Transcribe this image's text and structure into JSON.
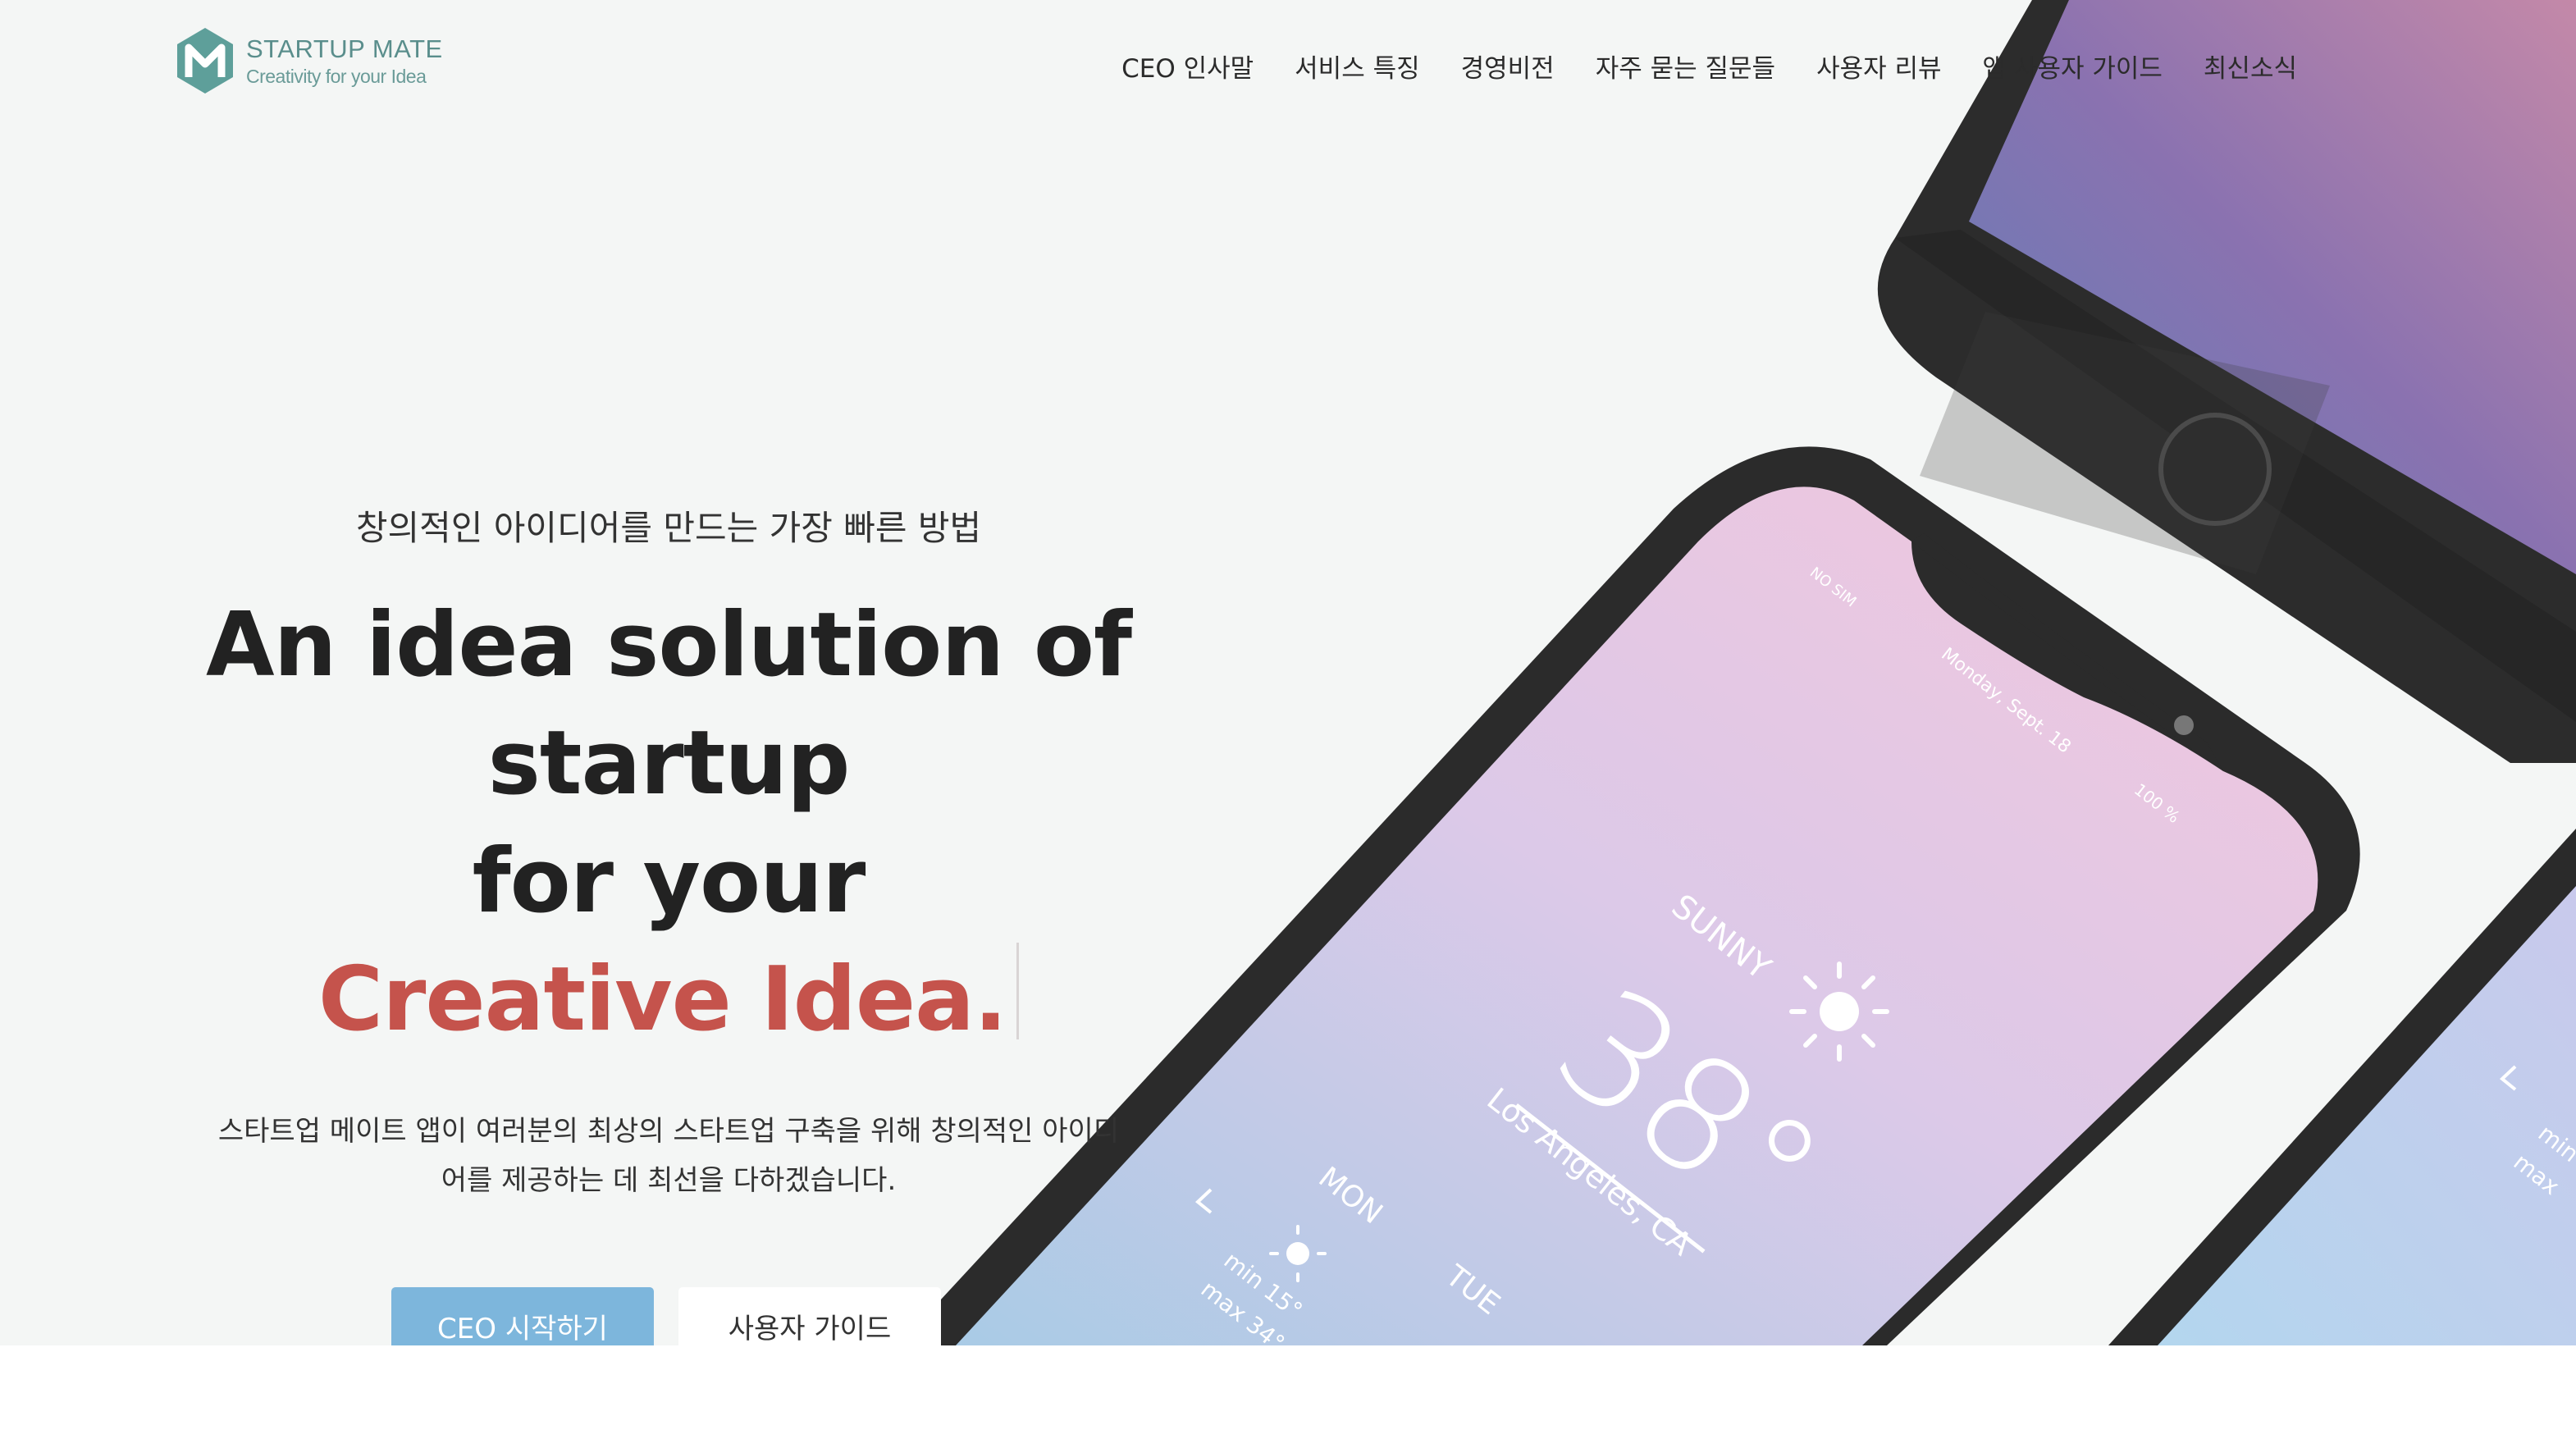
{
  "brand": {
    "name": "STARTUP MATE",
    "tagline": "Creativity for your Idea",
    "icon": "m-logo-icon"
  },
  "nav": {
    "items": [
      "CEO 인사말",
      "서비스 특징",
      "경영비전",
      "자주 묻는 질문들",
      "사용자 리뷰",
      "앱 사용자 가이드",
      "최신소식"
    ]
  },
  "hero": {
    "subtitle": "창의적인 아이디어를 만드는 가장 빠른 방법",
    "headline_line1": "An idea solution of startup",
    "headline_line2": "for your",
    "headline_accent": "Creative Idea.",
    "description": "스타트업 메이트 앱이 여러분의 최상의 스타트업 구축을 위해 창의적인 아이디어를 제공하는 데 최선을 다하겠습니다.",
    "primary_button": "CEO 시작하기",
    "secondary_button": "사용자 가이드"
  },
  "phone_screen": {
    "carrier": "NO SIM",
    "date": "Monday, Sept. 18",
    "battery": "100 %",
    "condition": "SUNNY",
    "temperature": "38°",
    "location": "Los Angeles, CA",
    "day1": "MON",
    "day1_min": "min 15°",
    "day1_max": "max 34°",
    "day2": "TUE",
    "right_min": "min",
    "right_max": "max"
  },
  "colors": {
    "accent": "#c5534c",
    "primary_button": "#7db6dc",
    "brand": "#5a8e8c",
    "background": "#f4f6f5"
  }
}
